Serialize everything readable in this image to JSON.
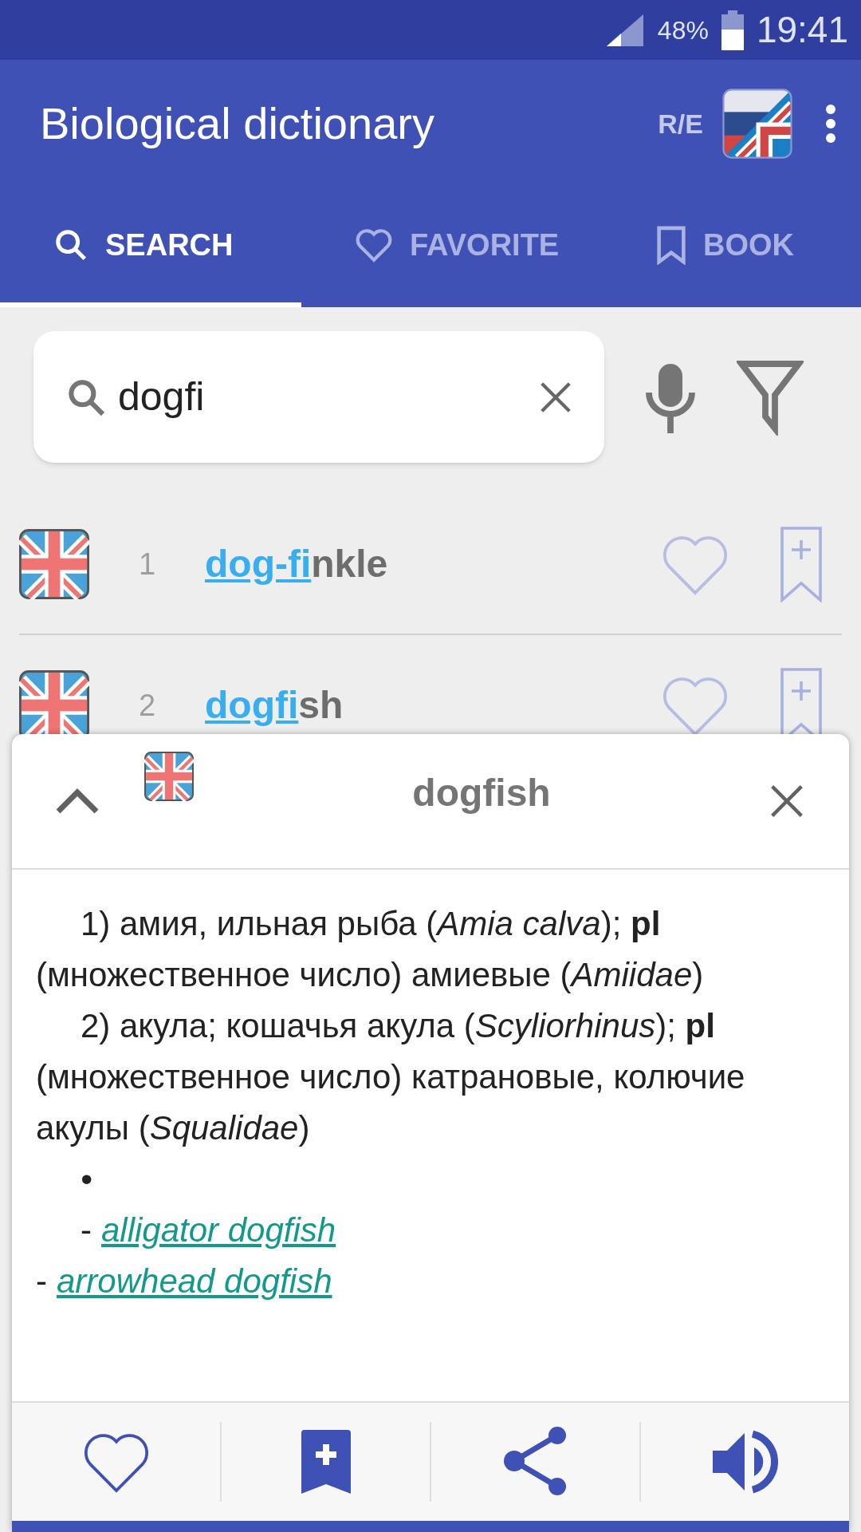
{
  "status_bar": {
    "battery": "48%",
    "time": "19:41"
  },
  "app_bar": {
    "title": "Biological dictionary",
    "direction": "R/E"
  },
  "tabs": [
    {
      "kind": "search",
      "label": "SEARCH",
      "selected": true
    },
    {
      "kind": "favorite",
      "label": "FAVORITE",
      "selected": false
    },
    {
      "kind": "bookmark",
      "label": "BOOK",
      "selected": false
    }
  ],
  "search": {
    "value": "dogfi"
  },
  "results": [
    {
      "number": "1",
      "match": "dog-fi",
      "rest": "nkle",
      "favorite": false,
      "bookmarked": false
    },
    {
      "number": "2",
      "match": "dogfi",
      "rest": "sh",
      "favorite": false,
      "bookmarked": false
    }
  ],
  "entry": {
    "title": "dogfish",
    "definition": [
      {
        "kind": "text",
        "text": "1) амия, ильная рыба (*Amia calva*); **pl** (множественное число) амиевые (*Amiidae*)"
      },
      {
        "kind": "text",
        "text": "2) акула; кошачья акула (*Scyliorhinus*); **pl** (множественное число) катрановые, колючие акулы (*Squalidae*)"
      },
      {
        "kind": "bullet",
        "text": "•"
      },
      {
        "kind": "indented_link",
        "dash": "-",
        "text": "alligator dogfish"
      },
      {
        "kind": "link",
        "dash": "-",
        "text": "arrowhead dogfish"
      }
    ]
  }
}
